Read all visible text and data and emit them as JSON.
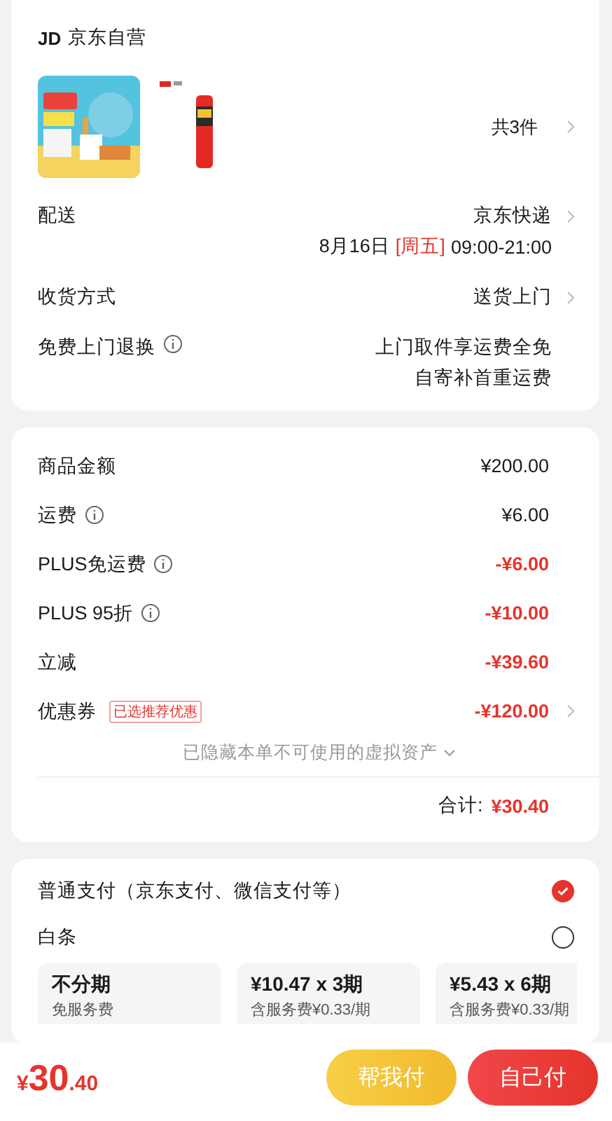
{
  "shop": {
    "logo": "JD",
    "name": "京东自营"
  },
  "products": {
    "count": "共3件",
    "chevron": true
  },
  "details": [
    {
      "label": "配送",
      "info": false,
      "value": "京东快递",
      "chevron": true,
      "schedule": {
        "date": "8月16日",
        "weekday": "[周五]",
        "time": "09:00-21:00"
      }
    },
    {
      "label": "收货方式",
      "info": false,
      "value": "送货上门",
      "chevron": true
    },
    {
      "label": "免费上门退换",
      "info": true,
      "value": "上门取件享运费全免",
      "value_2": "自寄补首重运费",
      "chevron": false
    }
  ],
  "prices": [
    {
      "label": "商品金额",
      "info": false,
      "value": "¥200.00",
      "discount": false,
      "chevron": false
    },
    {
      "label": "运费",
      "info": true,
      "value": "¥6.00",
      "discount": false,
      "chevron": false
    },
    {
      "label": "PLUS免运费",
      "info": true,
      "value": "-¥6.00",
      "discount": true,
      "chevron": false
    },
    {
      "label": "PLUS 95折",
      "info": true,
      "value": "-¥10.00",
      "discount": true,
      "chevron": false
    },
    {
      "label": "立减",
      "info": false,
      "value": "-¥39.60",
      "discount": true,
      "chevron": false
    },
    {
      "label": "优惠券",
      "info": false,
      "tag": "已选推荐优惠",
      "value": "-¥120.00",
      "discount": true,
      "chevron": true
    }
  ],
  "hidden_assets": "已隐藏本单不可使用的虚拟资产",
  "subtotal": {
    "label": "合计:",
    "value": "¥30.40"
  },
  "payment_methods": [
    {
      "label": "普通支付（京东支付、微信支付等）",
      "selected": true
    },
    {
      "label": "白条",
      "selected": false
    }
  ],
  "plans": [
    {
      "title": "不分期",
      "note": "免服务费"
    },
    {
      "title": "¥10.47 x 3期",
      "note": "含服务费¥0.33/期"
    },
    {
      "title": "¥5.43 x 6期",
      "note": "含服务费¥0.33/期"
    }
  ],
  "footer": {
    "currency": "¥",
    "integer": "30",
    "fraction": ".40",
    "buttons": [
      {
        "label": "帮我付",
        "kind": "helper"
      },
      {
        "label": "自己付",
        "kind": "primary"
      }
    ]
  }
}
